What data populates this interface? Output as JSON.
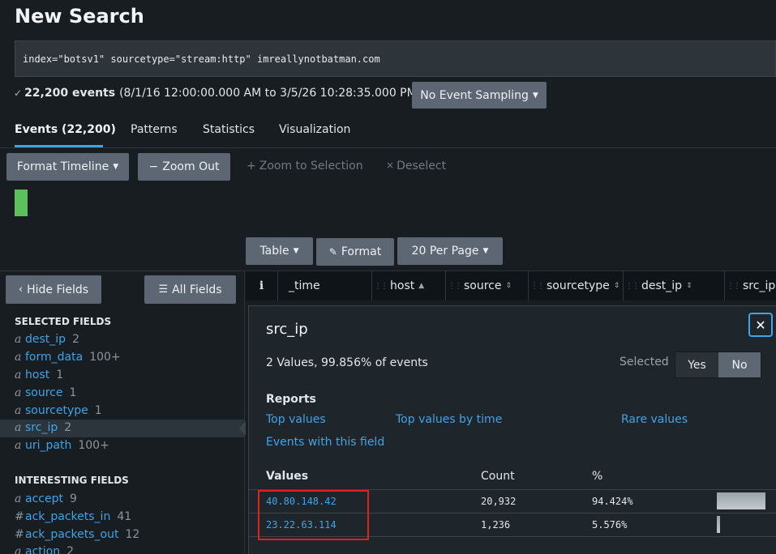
{
  "page": {
    "title": "New Search"
  },
  "search": {
    "query": "index=\"botsv1\" sourcetype=\"stream:http\" imreallynotbatman.com"
  },
  "summary": {
    "check": "✓",
    "events": "22,200 events",
    "range": "(8/1/16 12:00:00.000 AM to 3/5/26 10:28:35.000 PM)",
    "sampling": "No Event Sampling"
  },
  "tabs": [
    "Events (22,200)",
    "Patterns",
    "Statistics",
    "Visualization"
  ],
  "timeline": {
    "format": "Format Timeline",
    "zoom_out": "Zoom Out",
    "zoom_selection": "Zoom to Selection",
    "deselect": "Deselect"
  },
  "results_toolbar": {
    "table": "Table",
    "format": "Format",
    "per_page": "20 Per Page"
  },
  "sidebar": {
    "hide": "Hide Fields",
    "all": "All Fields",
    "selected_title": "SELECTED FIELDS",
    "selected": [
      {
        "type": "a",
        "name": "dest_ip",
        "count": "2"
      },
      {
        "type": "a",
        "name": "form_data",
        "count": "100+"
      },
      {
        "type": "a",
        "name": "host",
        "count": "1"
      },
      {
        "type": "a",
        "name": "source",
        "count": "1"
      },
      {
        "type": "a",
        "name": "sourcetype",
        "count": "1"
      },
      {
        "type": "a",
        "name": "src_ip",
        "count": "2"
      },
      {
        "type": "a",
        "name": "uri_path",
        "count": "100+"
      }
    ],
    "interesting_title": "INTERESTING FIELDS",
    "interesting": [
      {
        "type": "a",
        "name": "accept",
        "count": "9"
      },
      {
        "type": "#",
        "name": "ack_packets_in",
        "count": "41"
      },
      {
        "type": "#",
        "name": "ack_packets_out",
        "count": "12"
      },
      {
        "type": "a",
        "name": "action",
        "count": "2"
      }
    ]
  },
  "columns": {
    "info": "i",
    "time": "_time",
    "host": "host",
    "source": "source",
    "sourcetype": "sourcetype",
    "dest_ip": "dest_ip",
    "src_ip": "src_ip"
  },
  "popup": {
    "field": "src_ip",
    "summary": "2 Values, 99.856% of events",
    "selected_label": "Selected",
    "yes": "Yes",
    "no": "No",
    "reports_title": "Reports",
    "reports": [
      "Top values",
      "Top values by time",
      "Rare values",
      "Events with this field"
    ],
    "headers": {
      "values": "Values",
      "count": "Count",
      "percent": "%"
    },
    "rows": [
      {
        "value": "40.80.148.42",
        "count": "20,932",
        "percent": "94.424%",
        "fraction": 0.94424
      },
      {
        "value": "23.22.63.114",
        "count": "1,236",
        "percent": "5.576%",
        "fraction": 0.05576
      }
    ],
    "close": "✕"
  },
  "colors": {
    "link": "#3fa4e8",
    "timeline_bar": "#5cc05c",
    "highlight": "#e0221f"
  }
}
